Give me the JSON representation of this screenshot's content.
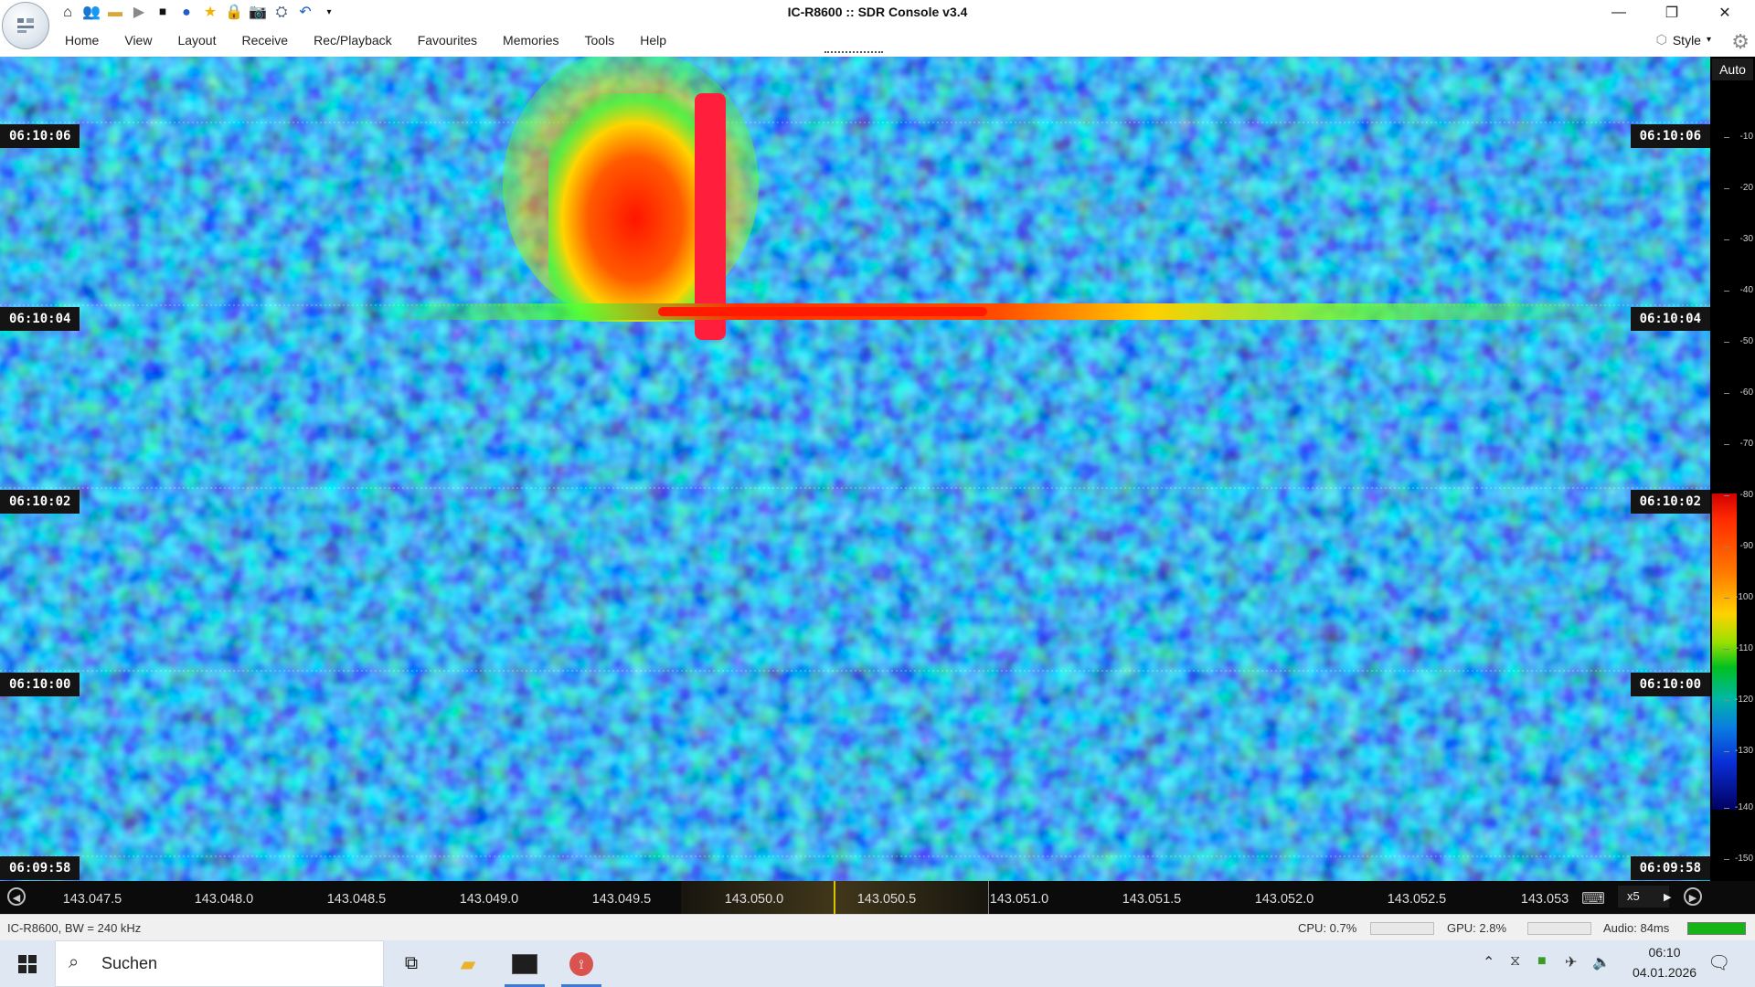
{
  "window": {
    "title": "IC-R8600 :: SDR Console v3.4"
  },
  "quick_access": {
    "icons": [
      "home-icon",
      "users-icon",
      "folder-icon",
      "play-icon",
      "stop-icon",
      "record-icon",
      "favourite-star-icon",
      "lock-icon",
      "camera-icon",
      "satellite-icon",
      "undo-icon",
      "customize-dropdown-icon"
    ]
  },
  "menu": {
    "tabs": [
      "Home",
      "View",
      "Layout",
      "Receive",
      "Rec/Playback",
      "Favourites",
      "Memories",
      "Tools",
      "Help"
    ],
    "style_label": "Style"
  },
  "waterfall": {
    "time_labels": [
      "06:10:06",
      "06:10:04",
      "06:10:02",
      "06:10:00",
      "06:09:58"
    ],
    "colors": {
      "background": "#2156d8",
      "signal": "#ff2000"
    }
  },
  "level_scale": {
    "auto_label": "Auto",
    "ticks": [
      "-10",
      "-20",
      "-30",
      "-40",
      "-50",
      "-60",
      "-70",
      "-80",
      "-90",
      "-100",
      "-110",
      "-120",
      "-130",
      "-140",
      "-150"
    ]
  },
  "frequency_axis": {
    "labels": [
      "143.047.5",
      "143.048.0",
      "143.048.5",
      "143.049.0",
      "143.049.5",
      "143.050.0",
      "143.050.5",
      "143.051.0",
      "143.051.5",
      "143.052.0",
      "143.052.5",
      "143.053"
    ],
    "zoom": "x5"
  },
  "status": {
    "device": "IC-R8600, BW = 240 kHz",
    "cpu": "CPU: 0.7%",
    "gpu": "GPU: 2.8%",
    "audio": "Audio: 84ms"
  },
  "taskbar": {
    "search_label": "Suchen",
    "clock_time": "06:10",
    "clock_date": "04.01.2026"
  }
}
